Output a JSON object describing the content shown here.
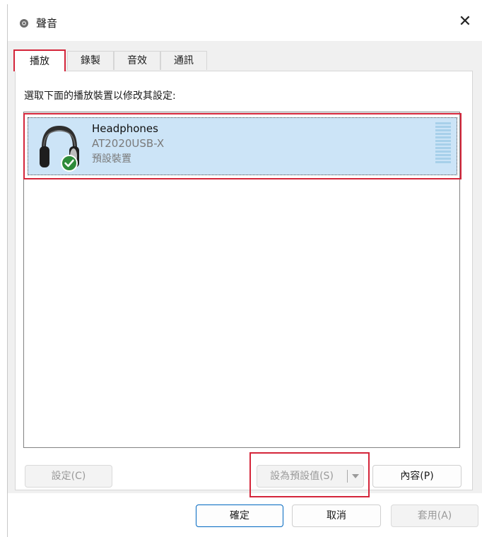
{
  "window": {
    "title": "聲音",
    "close_glyph": "✕"
  },
  "tabs": [
    {
      "label": "播放",
      "active": true
    },
    {
      "label": "錄製",
      "active": false
    },
    {
      "label": "音效",
      "active": false
    },
    {
      "label": "通訊",
      "active": false
    }
  ],
  "playback": {
    "instruction": "選取下面的播放裝置以修改其設定:",
    "devices": [
      {
        "name": "Headphones",
        "description": "AT2020USB-X",
        "status": "預設裝置",
        "icon": "headphones-icon",
        "default_badge": "check-badge-icon"
      }
    ]
  },
  "buttons": {
    "configure": "設定(C)",
    "set_default": "設為預設值(S)",
    "properties": "內容(P)",
    "ok": "確定",
    "cancel": "取消",
    "apply": "套用(A)"
  },
  "colors": {
    "selection_bg": "#cce4f7",
    "highlight_box": "#d4253a",
    "check_badge": "#2e8b3a",
    "primary_border": "#0067c0"
  }
}
